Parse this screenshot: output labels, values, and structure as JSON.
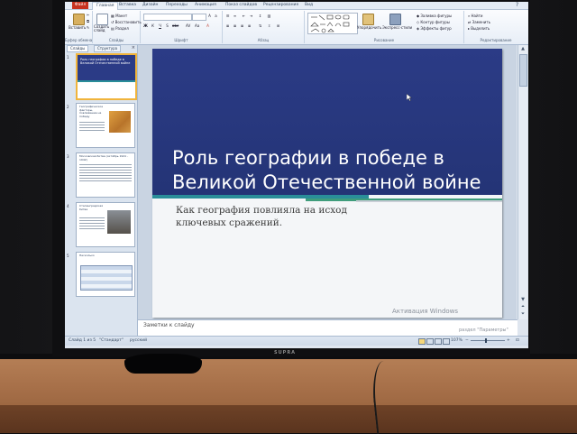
{
  "ribbon_tabs": [
    "Файл",
    "Главная",
    "Вставка",
    "Дизайн",
    "Переходы",
    "Анимация",
    "Показ слайдов",
    "Рецензирование",
    "Вид"
  ],
  "ribbon": {
    "clipboard": {
      "paste": "Вставить",
      "group": "Буфер обмена"
    },
    "slides": {
      "new_slide": "Создать слайд",
      "layout": "Макет",
      "reset": "Восстановить",
      "section": "Раздел",
      "group": "Слайды"
    },
    "font": {
      "group": "Шрифт"
    },
    "paragraph": {
      "group": "Абзац"
    },
    "drawing": {
      "arrange": "Упорядочить",
      "quick_styles": "Экспресс-стили",
      "fill": "Заливка фигуры",
      "outline": "Контур фигуры",
      "effects": "Эффекты фигур",
      "group": "Рисование"
    },
    "editing": {
      "find": "Найти",
      "replace": "Заменить",
      "select": "Выделить",
      "group": "Редактирование"
    }
  },
  "panel": {
    "tab_slides": "Слайды",
    "tab_outline": "Структура",
    "thumbnails": [
      {
        "num": "1",
        "title": "Роль географии в победе в Великой Отечественной войне"
      },
      {
        "num": "2",
        "title": "Географическое факторы, повлиявшие на победу"
      },
      {
        "num": "3",
        "title": "Московская битва (октябрь 1941 - 1942)"
      },
      {
        "num": "4",
        "title": "Сталинградская битва"
      },
      {
        "num": "5",
        "title": "Несколько"
      }
    ]
  },
  "slide": {
    "title": "Роль географии в победе в Великой Отечественной войне",
    "subtitle": "Как география повлияла на исход ключевых сражений.",
    "activation": "Активация Windows"
  },
  "notes": {
    "placeholder": "Заметки к слайду",
    "activation_hint": "раздел \"Параметры\""
  },
  "status": {
    "slide_info": "Слайд 1 из 5",
    "theme": "\"Стандарт\"",
    "language": "русский",
    "zoom": "107%"
  },
  "monitor_brand": "SUPRA",
  "colors": {
    "file_tab": "#c7321f",
    "slide_blue": "#2b3b86",
    "band_teal": "#2a8e99",
    "band_green": "#3f9d7c"
  }
}
